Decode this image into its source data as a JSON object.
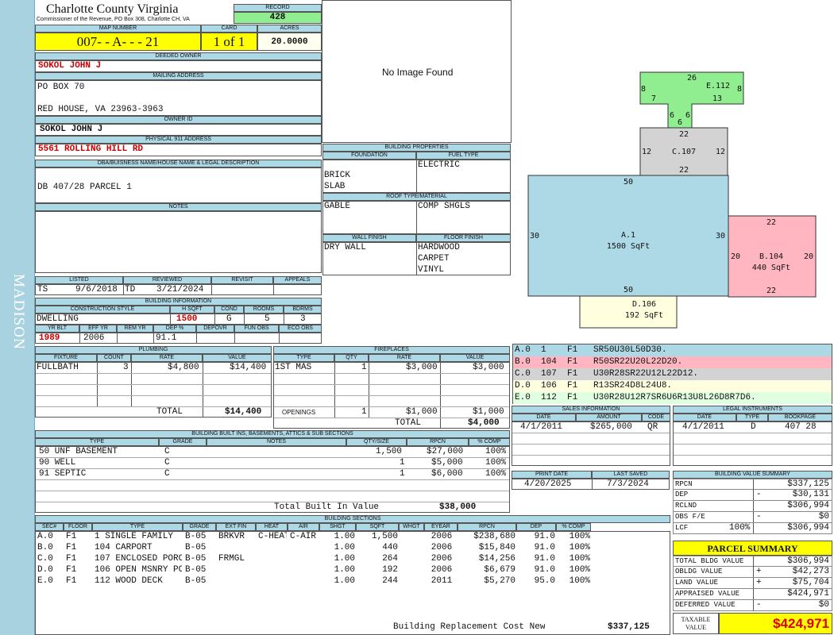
{
  "sidebar": {
    "label": "MADISON"
  },
  "county": {
    "name": "Charlotte County Virginia",
    "subtitle": "Commissioner of the Revenue, PO Box 308, Charlotte CH, VA"
  },
  "record": {
    "header": "RECORD",
    "value": "428"
  },
  "map": {
    "header": "MAP NUMBER",
    "value": "007- - A- - - 21"
  },
  "card": {
    "header": "CARD",
    "value": "1 of 1"
  },
  "acres": {
    "header": "ACRES",
    "value": "20.0000"
  },
  "owner": {
    "header": "DEEDED OWNER",
    "value": "SOKOL JOHN J"
  },
  "mailing": {
    "header": "MAILING ADDRESS",
    "line1": "PO BOX 70",
    "line2": "RED HOUSE, VA 23963-3963"
  },
  "owner_id": {
    "header": "OWNER ID",
    "value": "SOKOL JOHN J"
  },
  "physical": {
    "header": "PHYSICAL 911 ADDRESS",
    "value": "5561 ROLLING HILL RD"
  },
  "legal": {
    "header": "DBA/BUISNESS NAME/HOUSE NAME & LEGAL DESCRIPTION",
    "value": "DB 407/28 PARCEL 1"
  },
  "notes": {
    "header": "NOTES"
  },
  "image": {
    "text": "No Image Found"
  },
  "building_props": {
    "header": "BUILDING PROPERTIES",
    "foundation_header": "FOUNDATION",
    "foundation": [
      "BRICK",
      "SLAB"
    ],
    "fuel_header": "FUEL TYPE",
    "fuel": "ELECTRIC",
    "roof_header": "ROOF TYPE/MATERIAL",
    "roof_type": "GABLE",
    "roof_material": "COMP SHGLS",
    "wall_header": "WALL FINISH",
    "wall": "DRY WALL",
    "floor_header": "FLOOR FINISH",
    "floor": [
      "HARDWOOD",
      "CARPET",
      "VINYL"
    ]
  },
  "dates": {
    "listed_header": "LISTED",
    "listed_code": "TS",
    "listed_date": "9/6/2018",
    "reviewed_header": "REVIEWED",
    "reviewed_code": "TD",
    "reviewed_date": "3/21/2024",
    "revisit_header": "REVISIT",
    "appeals_header": "APPEALS"
  },
  "building_info": {
    "header": "BUILDING INFORMATION",
    "style_header": "CONSTRUCTION STYLE",
    "style": "DWELLING",
    "hsqft_header": "H SQFT",
    "hsqft": "1500",
    "cond_header": "COND",
    "cond": "G",
    "rooms_header": "ROOMS",
    "rooms": "5",
    "bdrms_header": "BDRMS",
    "bdrms": "3",
    "yrblt_header": "YR BLT",
    "yrblt": "1989",
    "effyr_header": "EFF YR",
    "effyr": "2006",
    "remyr_header": "REM YR",
    "remyr": "",
    "dep_header": "DEP %",
    "dep": "91.1",
    "depovr_header": "DEPOVR",
    "funobs_header": "FUN OBS",
    "ecoobs_header": "ECO OBS"
  },
  "plumbing": {
    "header": "PLUMBING",
    "columns": [
      "FIXTURE",
      "COUNT",
      "RATE",
      "VALUE"
    ],
    "rows": [
      [
        "FULLBATH",
        "3",
        "$4,800",
        "$14,400"
      ]
    ],
    "total_label": "TOTAL",
    "total": "$14,400"
  },
  "fireplaces": {
    "header": "FIREPLACES",
    "columns": [
      "TYPE",
      "QTY",
      "RATE",
      "VALUE"
    ],
    "rows": [
      [
        "1ST MAS",
        "1",
        "$3,000",
        "$3,000"
      ]
    ],
    "openings_label": "OPENINGS",
    "openings_qty": "1",
    "openings_rate": "$1,000",
    "openings_value": "$1,000",
    "total_label": "TOTAL",
    "total": "$4,000"
  },
  "built_ins": {
    "header": "BUILDING BUILT INS, BASEMENTS, ATTICS & SUB SECTIONS",
    "columns": [
      "TYPE",
      "GRADE",
      "NOTES",
      "QTY/SIZE",
      "RPCN",
      "% COMP"
    ],
    "rows": [
      [
        "50 UNF BASEMENT",
        "C",
        "",
        "1,500",
        "$27,000",
        "100%"
      ],
      [
        "90 WELL",
        "C",
        "",
        "1",
        "$5,000",
        "100%"
      ],
      [
        "91 SEPTIC",
        "C",
        "",
        "1",
        "$6,000",
        "100%"
      ]
    ],
    "total_label": "Total Built In Value",
    "total": "$38,000"
  },
  "sections": {
    "header": "BUILDING SECTIONS",
    "columns": [
      "SEC#",
      "FLOOR",
      "TYPE",
      "GRADE",
      "EXT FIN",
      "HEAT",
      "AIR",
      "SHGT",
      "SQFT",
      "WHGT",
      "EYEAR",
      "RPCN",
      "DEP",
      "% COMP"
    ],
    "rows": [
      [
        "A.0",
        "F1",
        "1 SINGLE FAMILY",
        "B-05",
        "BRKVR",
        "C-HEAT",
        "C-AIR",
        "1.00",
        "1,500",
        "",
        "2006",
        "$238,680",
        "91.0",
        "100%"
      ],
      [
        "B.0",
        "F1",
        "104 CARPORT",
        "B-05",
        "",
        "",
        "",
        "1.00",
        "440",
        "",
        "2006",
        "$15,840",
        "91.0",
        "100%"
      ],
      [
        "C.0",
        "F1",
        "107 ENCLOSED PORCH",
        "B-05",
        "FRMGL",
        "",
        "",
        "1.00",
        "264",
        "",
        "2006",
        "$14,256",
        "91.0",
        "100%"
      ],
      [
        "D.0",
        "F1",
        "106 OPEN MSNRY PCH",
        "B-05",
        "",
        "",
        "",
        "1.00",
        "192",
        "",
        "2006",
        "$6,679",
        "91.0",
        "100%"
      ],
      [
        "E.0",
        "F1",
        "112 WOOD DECK",
        "B-05",
        "",
        "",
        "",
        "1.00",
        "244",
        "",
        "2011",
        "$5,270",
        "95.0",
        "100%"
      ]
    ],
    "replacement_label": "Building Replacement Cost New",
    "replacement": "$337,125"
  },
  "sketch": {
    "A": {
      "label": "A.1",
      "area": "1500 SqFt",
      "top": "50",
      "bottom": "50",
      "left": "30",
      "right": "30",
      "color": "#add8e6"
    },
    "B": {
      "label": "B.104",
      "area": "440 SqFt",
      "top": "22",
      "bottom": "22",
      "left": "20",
      "right": "20",
      "color": "#ffb6c1"
    },
    "C": {
      "label": "C.107",
      "top": "22",
      "bottom": "22",
      "left": "12",
      "right": "12",
      "color": "#d3d3d3"
    },
    "D": {
      "label": "D.106",
      "area": "192 SqFt",
      "color": "#ffffe0"
    },
    "E": {
      "label": "E.112",
      "top": "26",
      "left": "8",
      "right": "8",
      "d1": "7",
      "d2": "13",
      "d3": "6",
      "d4": "6",
      "d5": "6",
      "color": "#90ee90"
    }
  },
  "sketch_codes": [
    {
      "text": "A.0  1    F1   SR50U30L50D30.",
      "color": "#add8e6"
    },
    {
      "text": "B.0  104  F1   R50SR22U20L22D20.",
      "color": "#ffb6c1"
    },
    {
      "text": "C.0  107  F1   U30R28SR22U12L22D12.",
      "color": "#d3d3d3"
    },
    {
      "text": "D.0  106  F1   R13SR24D8L24U8.",
      "color": "#ffffe0"
    },
    {
      "text": "E.0  112  F1   U30R28U12R7SR6U6R13U8L26D8R7D6.",
      "color": "#e0ffe0"
    }
  ],
  "sales": {
    "header": "SALES INFORMATION",
    "columns": [
      "DATE",
      "AMOUNT",
      "CODE"
    ],
    "rows": [
      [
        "4/1/2011",
        "$265,000",
        "QR"
      ]
    ]
  },
  "legal_instruments": {
    "header": "LEGAL INSTRUMENTS",
    "columns": [
      "DATE",
      "TYPE",
      "BOOKPAGE"
    ],
    "rows": [
      [
        "4/1/2011",
        "D",
        "407 28"
      ]
    ]
  },
  "print": {
    "print_header": "PRINT DATE",
    "print_date": "4/20/2025",
    "saved_header": "LAST SAVED",
    "saved_date": "7/3/2024"
  },
  "value_summary": {
    "header": "BUILDING VALUE SUMMARY",
    "rows": [
      {
        "label": "RPCN",
        "sign": "",
        "value": "$337,125"
      },
      {
        "label": "DEP",
        "sign": "-",
        "value": "$30,131"
      },
      {
        "label": "RCLND",
        "sign": "",
        "value": "$306,994"
      },
      {
        "label": "OBS F/E",
        "sign": "-",
        "value": "$0"
      },
      {
        "label": "LCF",
        "pct": "100%",
        "sign": "",
        "value": "$306,994"
      }
    ]
  },
  "parcel_summary": {
    "header": "PARCEL SUMMARY",
    "rows": [
      {
        "label": "TOTAL BLDG VALUE",
        "sign": "",
        "value": "$306,994"
      },
      {
        "label": "OBLDG VALUE",
        "sign": "+",
        "value": "$42,273"
      },
      {
        "label": "LAND VALUE",
        "sign": "+",
        "value": "$75,704"
      },
      {
        "label": "APPRAISED VALUE",
        "sign": "",
        "value": "$424,971"
      },
      {
        "label": "DEFERRED VALUE",
        "sign": "-",
        "value": "$0"
      }
    ],
    "taxable_label1": "TAXABLE",
    "taxable_label2": "VALUE",
    "taxable": "$424,971"
  }
}
